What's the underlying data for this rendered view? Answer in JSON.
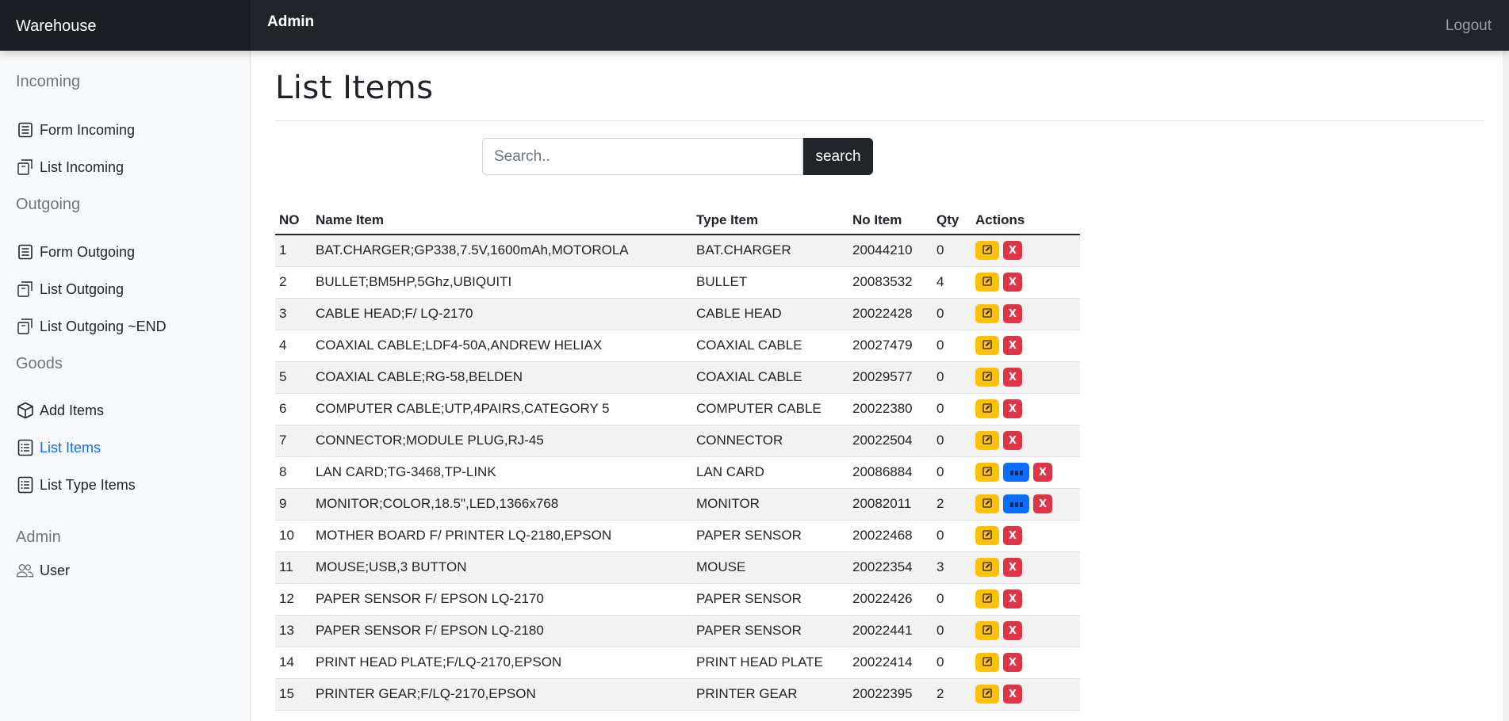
{
  "app": {
    "brand": "Warehouse",
    "title": "Admin",
    "logout": "Logout"
  },
  "sidebar": {
    "sections": [
      {
        "heading": "Incoming",
        "items": [
          {
            "label": "Form Incoming",
            "icon": "form-icon"
          },
          {
            "label": "List Incoming",
            "icon": "boxes-icon"
          }
        ]
      },
      {
        "heading": "Outgoing",
        "items": [
          {
            "label": "Form Outgoing",
            "icon": "form-icon"
          },
          {
            "label": "List Outgoing",
            "icon": "boxes-icon"
          },
          {
            "label": "List Outgoing ~END",
            "icon": "boxes-icon"
          }
        ]
      },
      {
        "heading": "Goods",
        "items": [
          {
            "label": "Add Items",
            "icon": "box-icon"
          },
          {
            "label": "List Items",
            "icon": "list-icon",
            "active": true
          },
          {
            "label": "List Type Items",
            "icon": "list-icon"
          }
        ]
      },
      {
        "heading": "Admin",
        "items": [
          {
            "label": "User",
            "icon": "users-icon"
          }
        ]
      }
    ]
  },
  "main": {
    "title": "List Items",
    "search": {
      "placeholder": "Search..",
      "button": "search"
    },
    "table": {
      "headers": [
        "NO",
        "Name Item",
        "Type Item",
        "No Item",
        "Qty",
        "Actions"
      ],
      "rows": [
        {
          "no": "1",
          "name": "BAT.CHARGER;GP338,7.5V,1600mAh,MOTOROLA",
          "type": "BAT.CHARGER",
          "item_no": "20044210",
          "qty": "0",
          "detail": false
        },
        {
          "no": "2",
          "name": "BULLET;BM5HP,5Ghz,UBIQUITI",
          "type": "BULLET",
          "item_no": "20083532",
          "qty": "4",
          "detail": false
        },
        {
          "no": "3",
          "name": "CABLE HEAD;F/ LQ-2170",
          "type": "CABLE HEAD",
          "item_no": "20022428",
          "qty": "0",
          "detail": false
        },
        {
          "no": "4",
          "name": "COAXIAL CABLE;LDF4-50A,ANDREW HELIAX",
          "type": "COAXIAL CABLE",
          "item_no": "20027479",
          "qty": "0",
          "detail": false
        },
        {
          "no": "5",
          "name": "COAXIAL CABLE;RG-58,BELDEN",
          "type": "COAXIAL CABLE",
          "item_no": "20029577",
          "qty": "0",
          "detail": false
        },
        {
          "no": "6",
          "name": "COMPUTER CABLE;UTP,4PAIRS,CATEGORY 5",
          "type": "COMPUTER CABLE",
          "item_no": "20022380",
          "qty": "0",
          "detail": false
        },
        {
          "no": "7",
          "name": "CONNECTOR;MODULE PLUG,RJ-45",
          "type": "CONNECTOR",
          "item_no": "20022504",
          "qty": "0",
          "detail": false
        },
        {
          "no": "8",
          "name": "LAN CARD;TG-3468,TP-LINK",
          "type": "LAN CARD",
          "item_no": "20086884",
          "qty": "0",
          "detail": true
        },
        {
          "no": "9",
          "name": "MONITOR;COLOR,18.5\",LED,1366x768",
          "type": "MONITOR",
          "item_no": "20082011",
          "qty": "2",
          "detail": true
        },
        {
          "no": "10",
          "name": "MOTHER BOARD F/ PRINTER LQ-2180,EPSON",
          "type": "PAPER SENSOR",
          "item_no": "20022468",
          "qty": "0",
          "detail": false
        },
        {
          "no": "11",
          "name": "MOUSE;USB,3 BUTTON",
          "type": "MOUSE",
          "item_no": "20022354",
          "qty": "3",
          "detail": false
        },
        {
          "no": "12",
          "name": "PAPER SENSOR F/ EPSON LQ-2170",
          "type": "PAPER SENSOR",
          "item_no": "20022426",
          "qty": "0",
          "detail": false
        },
        {
          "no": "13",
          "name": "PAPER SENSOR F/ EPSON LQ-2180",
          "type": "PAPER SENSOR",
          "item_no": "20022441",
          "qty": "0",
          "detail": false
        },
        {
          "no": "14",
          "name": "PRINT HEAD PLATE;F/LQ-2170,EPSON",
          "type": "PRINT HEAD PLATE",
          "item_no": "20022414",
          "qty": "0",
          "detail": false
        },
        {
          "no": "15",
          "name": "PRINTER GEAR;F/LQ-2170,EPSON",
          "type": "PRINTER GEAR",
          "item_no": "20022395",
          "qty": "2",
          "detail": false
        }
      ],
      "delete_label": "X"
    }
  },
  "colors": {
    "topbar": "#212529",
    "accent": "#0d6efd",
    "edit": "#ffc107",
    "delete": "#dc3545"
  }
}
